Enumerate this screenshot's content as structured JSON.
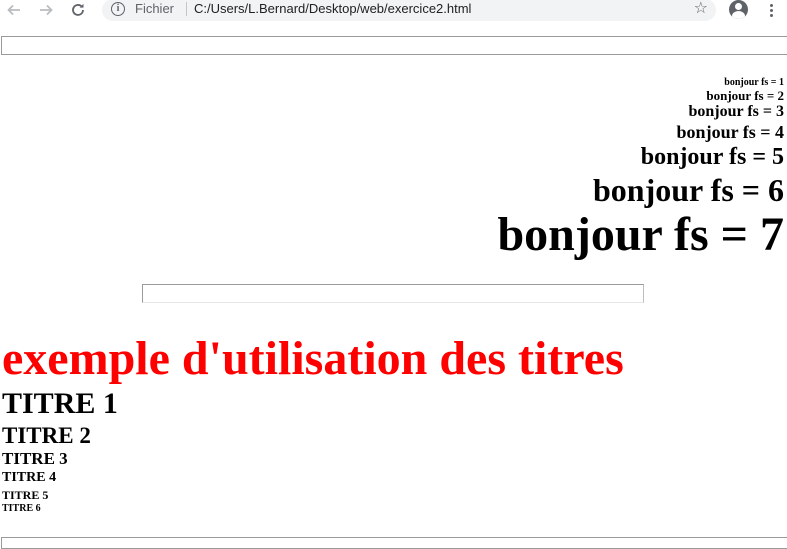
{
  "browser": {
    "back_icon": "arrow-left-icon",
    "forward_icon": "arrow-right-icon",
    "reload_icon": "reload-icon",
    "scheme_label": "Fichier",
    "url": "C:/Users/L.Bernard/Desktop/web/exercice2.html",
    "bookmark_icon": "star-icon",
    "account_icon": "account-icon",
    "menu_icon": "kebab-menu-icon"
  },
  "font_sizes": [
    "bonjour fs = 1",
    "bonjour fs = 2",
    "bonjour fs = 3",
    "bonjour fs = 4",
    "bonjour fs = 5",
    "bonjour fs = 6",
    "bonjour fs = 7"
  ],
  "main_title": "exemple d'utilisation des titres",
  "main_title_color": "#ff0000",
  "titles": [
    "TITRE 1",
    "TITRE 2",
    "TITRE 3",
    "TITRE 4",
    "TITRE 5",
    "TITRE 6"
  ]
}
